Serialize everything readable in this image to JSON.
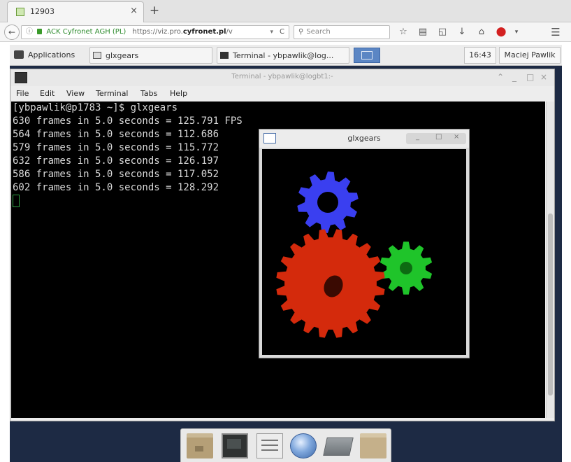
{
  "browser": {
    "tab": {
      "title": "12903",
      "close": "×"
    },
    "new_tab": "+",
    "url_bar": {
      "info": "ⓘ",
      "cert": "ACK Cyfronet AGH (PL)",
      "url_prefix": "https://viz.pro.",
      "url_domain": "cyfronet.pl",
      "url_suffix": "/v",
      "dropdown": "▾",
      "reload": "C"
    },
    "search": {
      "icon": "🔍",
      "placeholder": "Search"
    },
    "toolbar_icons": [
      "star-icon",
      "reading-list-icon",
      "pocket-icon",
      "download-icon",
      "home-icon",
      "adblock-icon",
      "menu-icon"
    ]
  },
  "remote": {
    "panel": {
      "applications": "Applications",
      "window_glxgears": "glxgears",
      "window_terminal": "Terminal - ybpawlik@log...",
      "clock": "16:43",
      "user": "Maciej Pawlik"
    },
    "terminal": {
      "title": "Terminal - ybpawlik@logbt1:-",
      "controls": {
        "pin": "⌃",
        "minimize": "_",
        "maximize": "□",
        "close": "×"
      },
      "menu": [
        "File",
        "Edit",
        "View",
        "Terminal",
        "Tabs",
        "Help"
      ],
      "lines": [
        "[ybpawlik@p1783 ~]$ glxgears",
        "630 frames in 5.0 seconds = 125.791 FPS",
        "564 frames in 5.0 seconds = 112.686",
        "579 frames in 5.0 seconds = 115.772",
        "632 frames in 5.0 seconds = 126.197",
        "586 frames in 5.0 seconds = 117.052",
        "602 frames in 5.0 seconds = 128.292"
      ]
    },
    "glxgears": {
      "title": "glxgears",
      "controls": {
        "minimize": "_",
        "maximize": "□",
        "close": "×"
      },
      "gear_colors": {
        "red": "#d42a0c",
        "green": "#1fc42a",
        "blue": "#3a3ff0"
      }
    },
    "dock": [
      "file-manager-icon",
      "terminal-icon",
      "text-editor-icon",
      "web-browser-icon",
      "disk-icon",
      "folder-icon"
    ]
  }
}
